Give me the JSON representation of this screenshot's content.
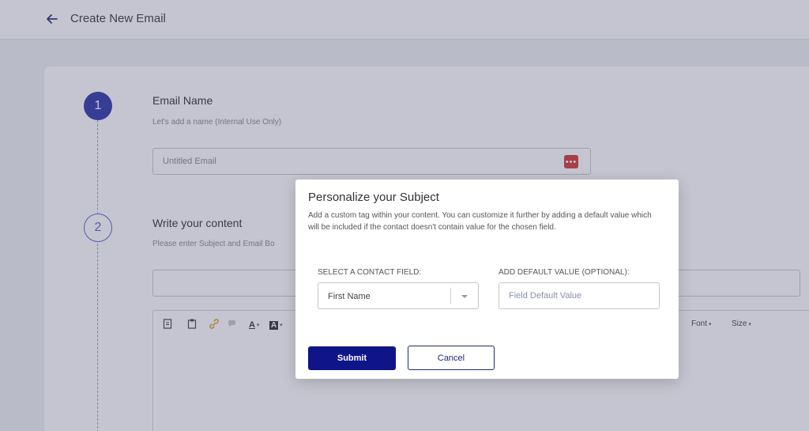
{
  "header": {
    "title": "Create New Email",
    "back_icon": "arrow-left-icon"
  },
  "steps": [
    {
      "number": "1",
      "title": "Email Name",
      "subtitle": "Let's add a name (Internal Use Only)"
    },
    {
      "number": "2",
      "title": "Write your content",
      "subtitle": "Please enter Subject and Email Bo"
    }
  ],
  "email_name": {
    "value": "Untitled Email",
    "icon": "more-dots-icon",
    "icon_glyph": "•••"
  },
  "editor": {
    "toolbar": {
      "icons": [
        "source-icon",
        "paste-icon",
        "link-icon",
        "unlink-icon",
        "text-color-icon",
        "bg-color-icon"
      ],
      "text_color_glyph": "A",
      "bg_color_glyph": "A",
      "font_label": "Font",
      "size_label": "Size"
    }
  },
  "modal": {
    "title": "Personalize your Subject",
    "description": "Add a custom tag within your content. You can customize it further by adding a default value which will be included if the contact doesn't contain value for the chosen field.",
    "contact_field_label": "SELECT A CONTACT FIELD:",
    "contact_field_value": "First Name",
    "default_value_label": "ADD DEFAULT VALUE (OPTIONAL):",
    "default_value_placeholder": "Field Default Value",
    "submit_label": "Submit",
    "cancel_label": "Cancel"
  },
  "colors": {
    "primary": "#0f1489",
    "step_active": "#2f37a8",
    "danger": "#d33a3a"
  }
}
